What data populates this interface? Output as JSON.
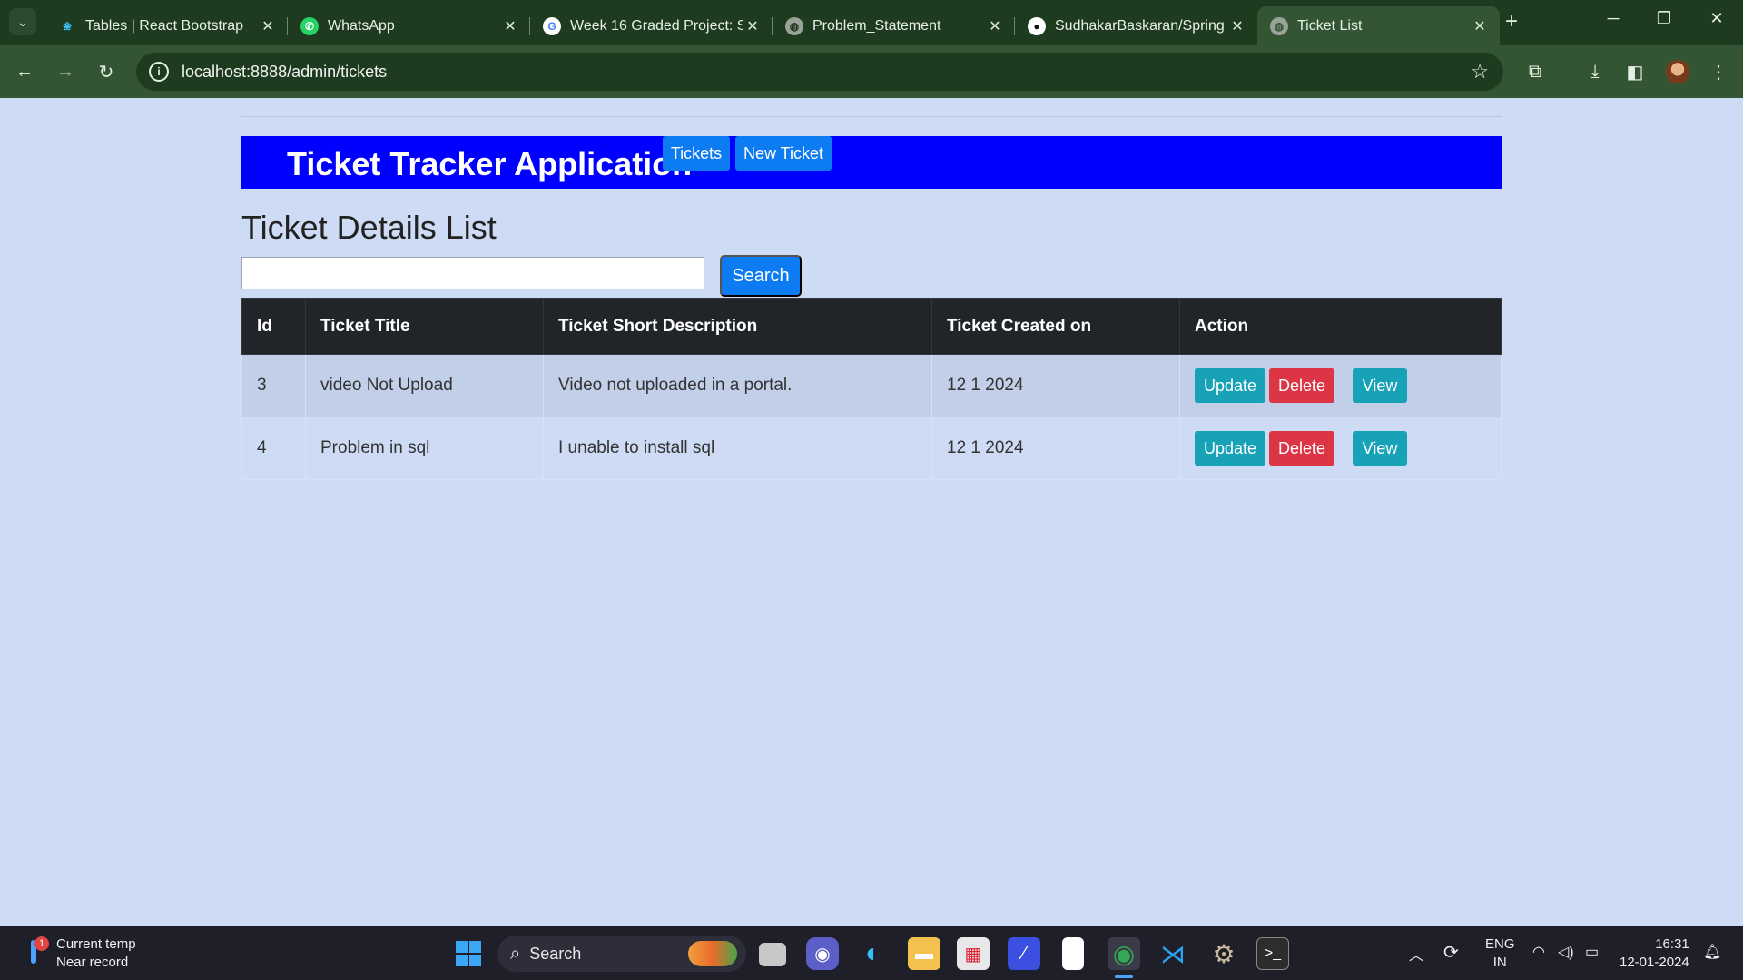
{
  "browser": {
    "tabs": [
      {
        "title": "Tables | React Bootstrap",
        "favicon": "react-bootstrap-icon",
        "active": false
      },
      {
        "title": "WhatsApp",
        "favicon": "whatsapp-icon",
        "active": false
      },
      {
        "title": "Week 16 Graded Project: S",
        "favicon": "google-icon",
        "active": false
      },
      {
        "title": "Problem_Statement",
        "favicon": "globe-icon",
        "active": false
      },
      {
        "title": "SudhakarBaskaran/Spring",
        "favicon": "github-icon",
        "active": false
      },
      {
        "title": "Ticket List",
        "favicon": "globe-icon",
        "active": true
      }
    ],
    "url": "localhost:8888/admin/tickets",
    "colors": {
      "frame": "#1f3b1f",
      "toolbar": "#335533"
    }
  },
  "app": {
    "brand": "Ticket Tracker Application",
    "nav": {
      "tickets": "Tickets",
      "new_ticket": "New Ticket"
    },
    "colors": {
      "header": "#0000ff",
      "primary": "#0d7cf2",
      "info": "#17a2b8",
      "danger": "#dc3545",
      "table_head": "#212529",
      "page_bg": "#cddcf4"
    }
  },
  "page": {
    "title": "Ticket Details List",
    "search": {
      "value": "",
      "button": "Search"
    }
  },
  "table": {
    "headers": [
      "Id",
      "Ticket Title",
      "Ticket Short Description",
      "Ticket Created on",
      "Action"
    ],
    "rows": [
      {
        "id": "3",
        "title": "video Not Upload",
        "description": "Video not uploaded in a portal.",
        "created": "12 1 2024"
      },
      {
        "id": "4",
        "title": "Problem in sql",
        "description": "I unable to install sql",
        "created": "12 1 2024"
      }
    ],
    "actions": {
      "update": "Update",
      "delete": "Delete",
      "view": "View"
    }
  },
  "taskbar": {
    "weather": {
      "line1": "Current temp",
      "line2": "Near record",
      "badge": "1"
    },
    "search": "Search",
    "lang": {
      "line1": "ENG",
      "line2": "IN"
    },
    "time": "16:31",
    "date": "12-01-2024"
  }
}
